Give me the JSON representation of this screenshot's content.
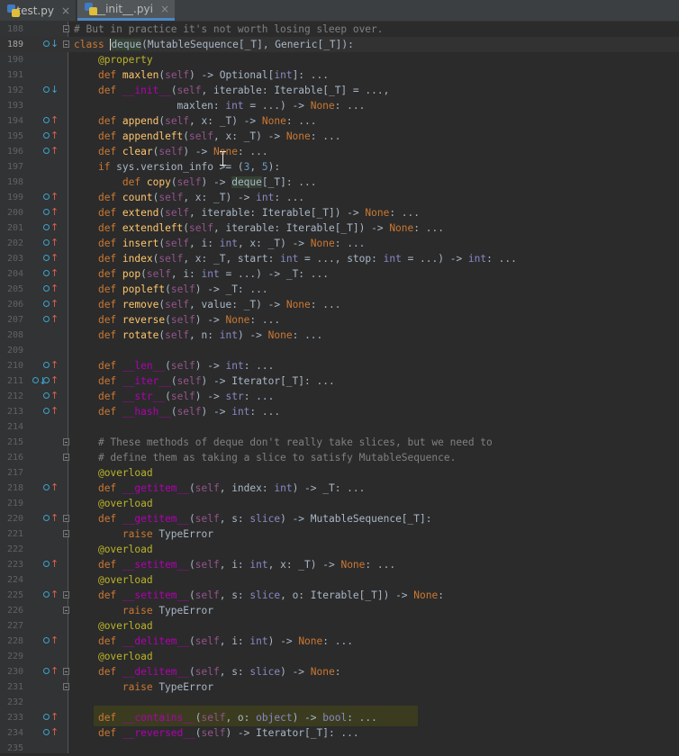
{
  "tabs": [
    {
      "label": "test.py",
      "active": false,
      "close": "×"
    },
    {
      "label": "__init__.pyi",
      "active": true,
      "close": "×"
    }
  ],
  "editor": {
    "current_line": 189,
    "lines": [
      {
        "n": "188",
        "gutter": "",
        "fold": "open",
        "code": "# But in practice it's not worth losing sleep over."
      },
      {
        "n": "189",
        "gutter": "o-down",
        "fold": "open",
        "code": "class deque(MutableSequence[_T], Generic[_T]):"
      },
      {
        "n": "190",
        "gutter": "",
        "fold": "",
        "code": "    @property"
      },
      {
        "n": "191",
        "gutter": "",
        "fold": "",
        "code": "    def maxlen(self) -> Optional[int]: ..."
      },
      {
        "n": "192",
        "gutter": "o-down",
        "fold": "",
        "code": "    def __init__(self, iterable: Iterable[_T] = ...,"
      },
      {
        "n": "193",
        "gutter": "",
        "fold": "",
        "code": "                 maxlen: int = ...) -> None: ..."
      },
      {
        "n": "194",
        "gutter": "o-up",
        "fold": "",
        "code": "    def append(self, x: _T) -> None: ..."
      },
      {
        "n": "195",
        "gutter": "o-up",
        "fold": "",
        "code": "    def appendleft(self, x: _T) -> None: ..."
      },
      {
        "n": "196",
        "gutter": "o-up",
        "fold": "",
        "code": "    def clear(self) -> None: ..."
      },
      {
        "n": "197",
        "gutter": "",
        "fold": "",
        "code": "    if sys.version_info >= (3, 5):"
      },
      {
        "n": "198",
        "gutter": "",
        "fold": "",
        "code": "        def copy(self) -> deque[_T]: ..."
      },
      {
        "n": "199",
        "gutter": "o-up",
        "fold": "",
        "code": "    def count(self, x: _T) -> int: ..."
      },
      {
        "n": "200",
        "gutter": "o-up",
        "fold": "",
        "code": "    def extend(self, iterable: Iterable[_T]) -> None: ..."
      },
      {
        "n": "201",
        "gutter": "o-up",
        "fold": "",
        "code": "    def extendleft(self, iterable: Iterable[_T]) -> None: ..."
      },
      {
        "n": "202",
        "gutter": "o-up",
        "fold": "",
        "code": "    def insert(self, i: int, x: _T) -> None: ..."
      },
      {
        "n": "203",
        "gutter": "o-up",
        "fold": "",
        "code": "    def index(self, x: _T, start: int = ..., stop: int = ...) -> int: ..."
      },
      {
        "n": "204",
        "gutter": "o-up",
        "fold": "",
        "code": "    def pop(self, i: int = ...) -> _T: ..."
      },
      {
        "n": "205",
        "gutter": "o-up",
        "fold": "",
        "code": "    def popleft(self) -> _T: ..."
      },
      {
        "n": "206",
        "gutter": "o-up",
        "fold": "",
        "code": "    def remove(self, value: _T) -> None: ..."
      },
      {
        "n": "207",
        "gutter": "o-up",
        "fold": "",
        "code": "    def reverse(self) -> None: ..."
      },
      {
        "n": "208",
        "gutter": "",
        "fold": "",
        "code": "    def rotate(self, n: int) -> None: ..."
      },
      {
        "n": "209",
        "gutter": "",
        "fold": "",
        "code": ""
      },
      {
        "n": "210",
        "gutter": "o-up",
        "fold": "",
        "code": "    def __len__(self) -> int: ..."
      },
      {
        "n": "211",
        "gutter": "o-down-up",
        "fold": "",
        "code": "    def __iter__(self) -> Iterator[_T]: ..."
      },
      {
        "n": "212",
        "gutter": "o-up",
        "fold": "",
        "code": "    def __str__(self) -> str: ..."
      },
      {
        "n": "213",
        "gutter": "o-up",
        "fold": "",
        "code": "    def __hash__(self) -> int: ..."
      },
      {
        "n": "214",
        "gutter": "",
        "fold": "",
        "code": ""
      },
      {
        "n": "215",
        "gutter": "",
        "fold": "open",
        "code": "    # These methods of deque don't really take slices, but we need to"
      },
      {
        "n": "216",
        "gutter": "",
        "fold": "open",
        "code": "    # define them as taking a slice to satisfy MutableSequence."
      },
      {
        "n": "217",
        "gutter": "",
        "fold": "",
        "code": "    @overload"
      },
      {
        "n": "218",
        "gutter": "o-up",
        "fold": "",
        "code": "    def __getitem__(self, index: int) -> _T: ..."
      },
      {
        "n": "219",
        "gutter": "",
        "fold": "",
        "code": "    @overload"
      },
      {
        "n": "220",
        "gutter": "o-up",
        "fold": "open",
        "code": "    def __getitem__(self, s: slice) -> MutableSequence[_T]:"
      },
      {
        "n": "221",
        "gutter": "",
        "fold": "open",
        "code": "        raise TypeError"
      },
      {
        "n": "222",
        "gutter": "",
        "fold": "",
        "code": "    @overload"
      },
      {
        "n": "223",
        "gutter": "o-up",
        "fold": "",
        "code": "    def __setitem__(self, i: int, x: _T) -> None: ..."
      },
      {
        "n": "224",
        "gutter": "",
        "fold": "",
        "code": "    @overload"
      },
      {
        "n": "225",
        "gutter": "o-up",
        "fold": "open",
        "code": "    def __setitem__(self, s: slice, o: Iterable[_T]) -> None:"
      },
      {
        "n": "226",
        "gutter": "",
        "fold": "open",
        "code": "        raise TypeError"
      },
      {
        "n": "227",
        "gutter": "",
        "fold": "",
        "code": "    @overload"
      },
      {
        "n": "228",
        "gutter": "o-up",
        "fold": "",
        "code": "    def __delitem__(self, i: int) -> None: ..."
      },
      {
        "n": "229",
        "gutter": "",
        "fold": "",
        "code": "    @overload"
      },
      {
        "n": "230",
        "gutter": "o-up",
        "fold": "open",
        "code": "    def __delitem__(self, s: slice) -> None:"
      },
      {
        "n": "231",
        "gutter": "",
        "fold": "open",
        "code": "        raise TypeError"
      },
      {
        "n": "232",
        "gutter": "",
        "fold": "",
        "code": ""
      },
      {
        "n": "233",
        "gutter": "o-up",
        "fold": "",
        "code": "    def __contains__(self, o: object) -> bool: ..."
      },
      {
        "n": "234",
        "gutter": "o-up",
        "fold": "",
        "code": "    def __reversed__(self) -> Iterator[_T]: ..."
      },
      {
        "n": "235",
        "gutter": "",
        "fold": "",
        "code": ""
      }
    ]
  },
  "colors": {
    "background": "#2b2b2b",
    "keyword": "#cc7832",
    "function": "#ffc66d",
    "dunder": "#b200b2",
    "self": "#94558d",
    "builtin": "#8888c6",
    "comment": "#808080",
    "number": "#6897bb",
    "decorator": "#bbb529",
    "text": "#a9b7c6"
  }
}
